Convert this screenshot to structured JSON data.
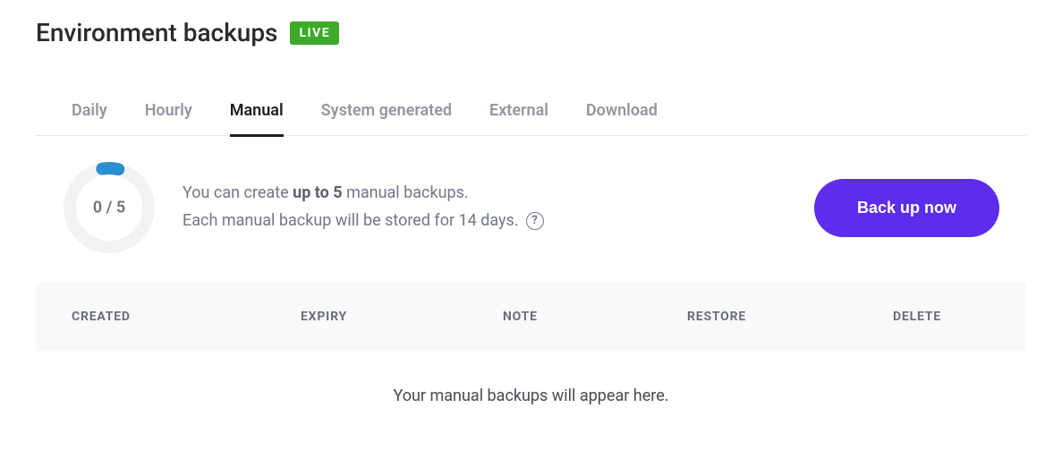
{
  "header": {
    "title": "Environment backups",
    "badge": "LIVE"
  },
  "tabs": [
    {
      "label": "Daily",
      "active": false
    },
    {
      "label": "Hourly",
      "active": false
    },
    {
      "label": "Manual",
      "active": true
    },
    {
      "label": "System generated",
      "active": false
    },
    {
      "label": "External",
      "active": false
    },
    {
      "label": "Download",
      "active": false
    }
  ],
  "gauge": {
    "label": "0 / 5",
    "used": 0,
    "total": 5
  },
  "info": {
    "line1_prefix": "You can create ",
    "line1_bold": "up to 5",
    "line1_suffix": " manual backups.",
    "line2": "Each manual backup will be stored for 14 days."
  },
  "actions": {
    "backup_now": "Back up now"
  },
  "table": {
    "columns": {
      "created": "CREATED",
      "expiry": "EXPIRY",
      "note": "NOTE",
      "restore": "RESTORE",
      "delete": "DELETE"
    },
    "empty_message": "Your manual backups will appear here."
  }
}
